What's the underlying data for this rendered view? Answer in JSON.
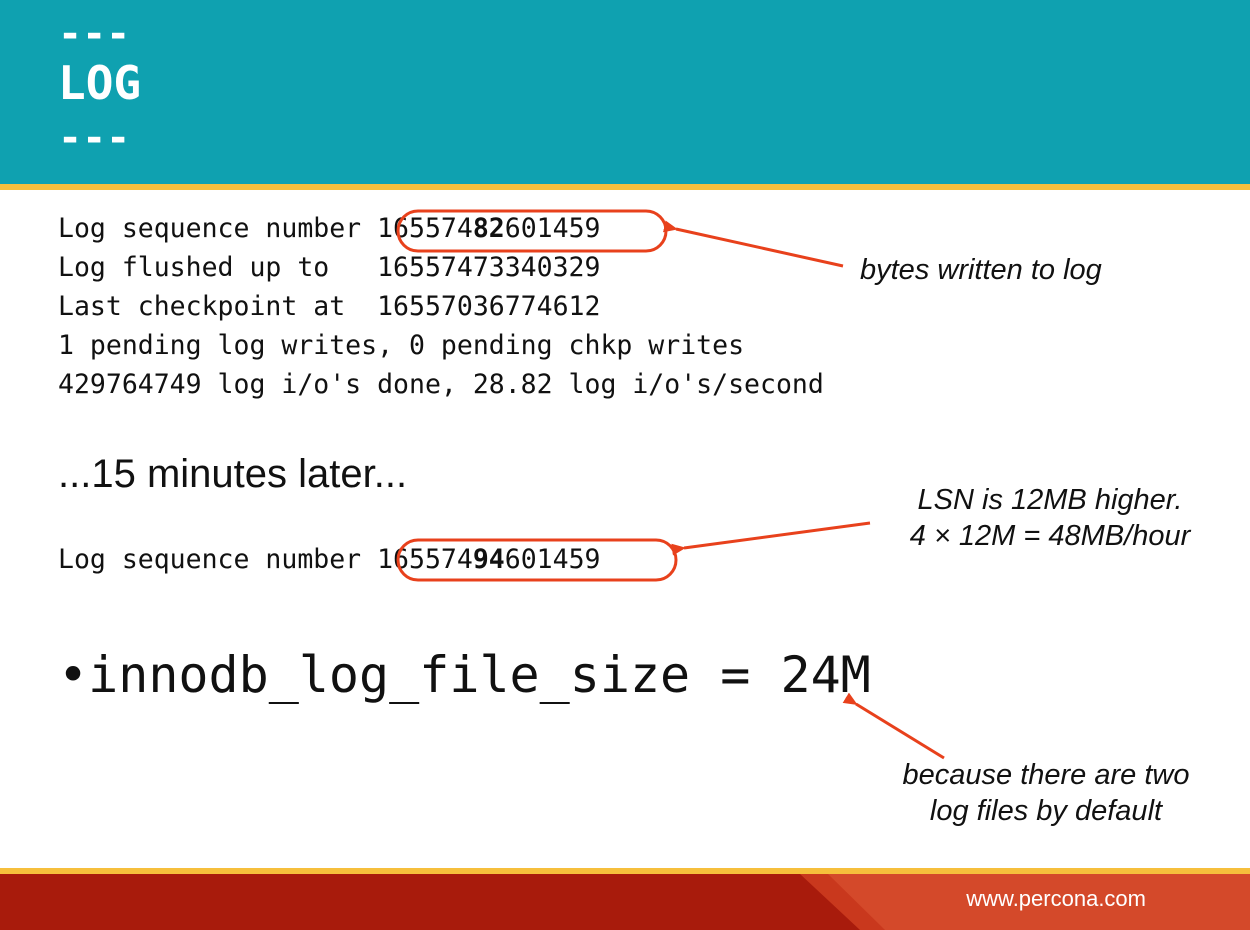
{
  "slide": {
    "title": "LOG",
    "title_dashes": "---",
    "log_lines": {
      "lsn_label": "Log sequence number ",
      "lsn_value_before": "165574",
      "lsn_value_bold": "82",
      "lsn_value_after": "601459",
      "flushed": "Log flushed up to   16557473340329",
      "checkpoint": "Last checkpoint at  16557036774612",
      "pending": "1 pending log writes, 0 pending chkp writes",
      "io": "429764749 log i/o's done, 28.82 log i/o's/second"
    },
    "later_text": "...15 minutes later...",
    "lsn_later": {
      "label": "Log sequence number ",
      "value_before": "165574",
      "value_bold": "94",
      "value_after": "601459"
    },
    "bullet_symbol": "•",
    "bullet_text": "innodb_log_file_size = 24M",
    "annotations": {
      "bytes_written": "bytes written to log",
      "lsn_higher_line1": "LSN is 12MB higher.",
      "lsn_higher_line2": "4 × 12M = 48MB/hour",
      "two_files_line1": "because there are two",
      "two_files_line2": "log files by default"
    },
    "footer_url": "www.percona.com"
  },
  "colors": {
    "header": "#0fa1b0",
    "stripe": "#f6bf3c",
    "footer": "#a81b0c",
    "annotation_red": "#e8411c"
  }
}
